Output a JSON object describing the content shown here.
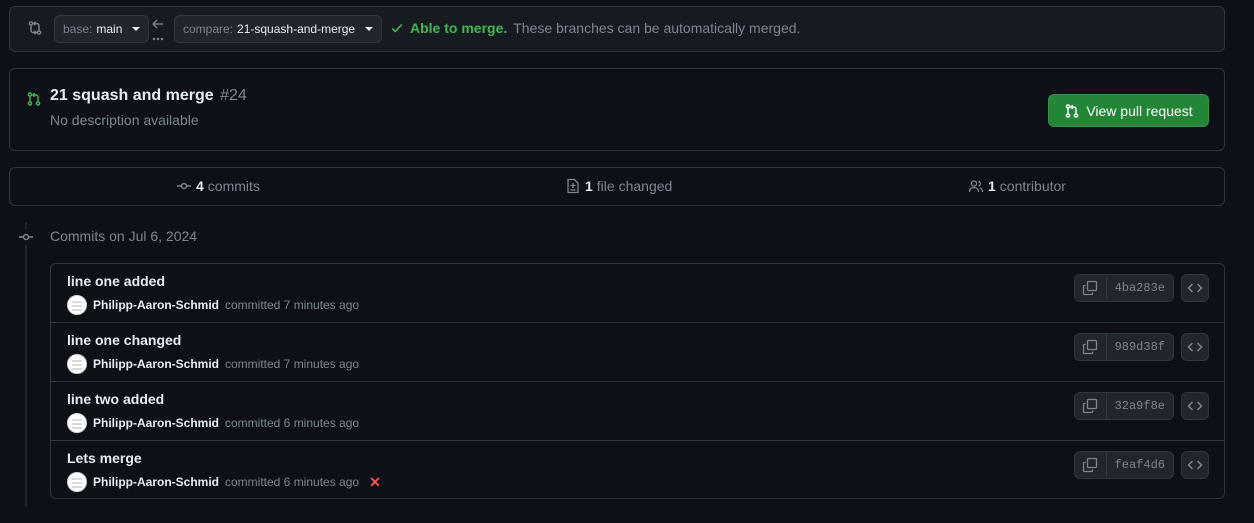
{
  "compare": {
    "base_prefix": "base:",
    "base_value": "main",
    "compare_prefix": "compare:",
    "compare_value": "21-squash-and-merge",
    "merge_ok": "Able to merge.",
    "merge_msg": "These branches can be automatically merged."
  },
  "pr": {
    "title": "21 squash and merge",
    "number": "#24",
    "description": "No description available",
    "button": "View pull request"
  },
  "stats": {
    "commits_num": "4",
    "commits_label": "commits",
    "files_num": "1",
    "files_label": "file changed",
    "contributors_num": "1",
    "contributors_label": "contributor"
  },
  "timeline": {
    "date_label": "Commits on Jul 6, 2024"
  },
  "commits": [
    {
      "message": "line one added",
      "author": "Philipp-Aaron-Schmid",
      "meta": "committed 7 minutes ago",
      "sha": "4ba283e"
    },
    {
      "message": "line one changed",
      "author": "Philipp-Aaron-Schmid",
      "meta": "committed 7 minutes ago",
      "sha": "989d38f"
    },
    {
      "message": "line two added",
      "author": "Philipp-Aaron-Schmid",
      "meta": "committed 6 minutes ago",
      "sha": "32a9f8e"
    },
    {
      "message": "Lets merge",
      "author": "Philipp-Aaron-Schmid",
      "meta": "committed 6 minutes ago",
      "sha": "feaf4d6",
      "status": "✕"
    }
  ],
  "colors": {
    "background": "#0d1117",
    "border": "#30363d",
    "success": "#3fb950",
    "button_green": "#238636",
    "failure": "#f85149",
    "muted": "#7d8590"
  },
  "icons": {
    "compare": "git-compare-icon",
    "arrow": "arrow-left-icon",
    "check": "check-icon",
    "pr": "git-pull-request-icon",
    "commit": "git-commit-icon",
    "file_diff": "file-diff-icon",
    "people": "people-icon",
    "copy": "copy-icon",
    "code": "code-icon",
    "x": "x-icon"
  }
}
